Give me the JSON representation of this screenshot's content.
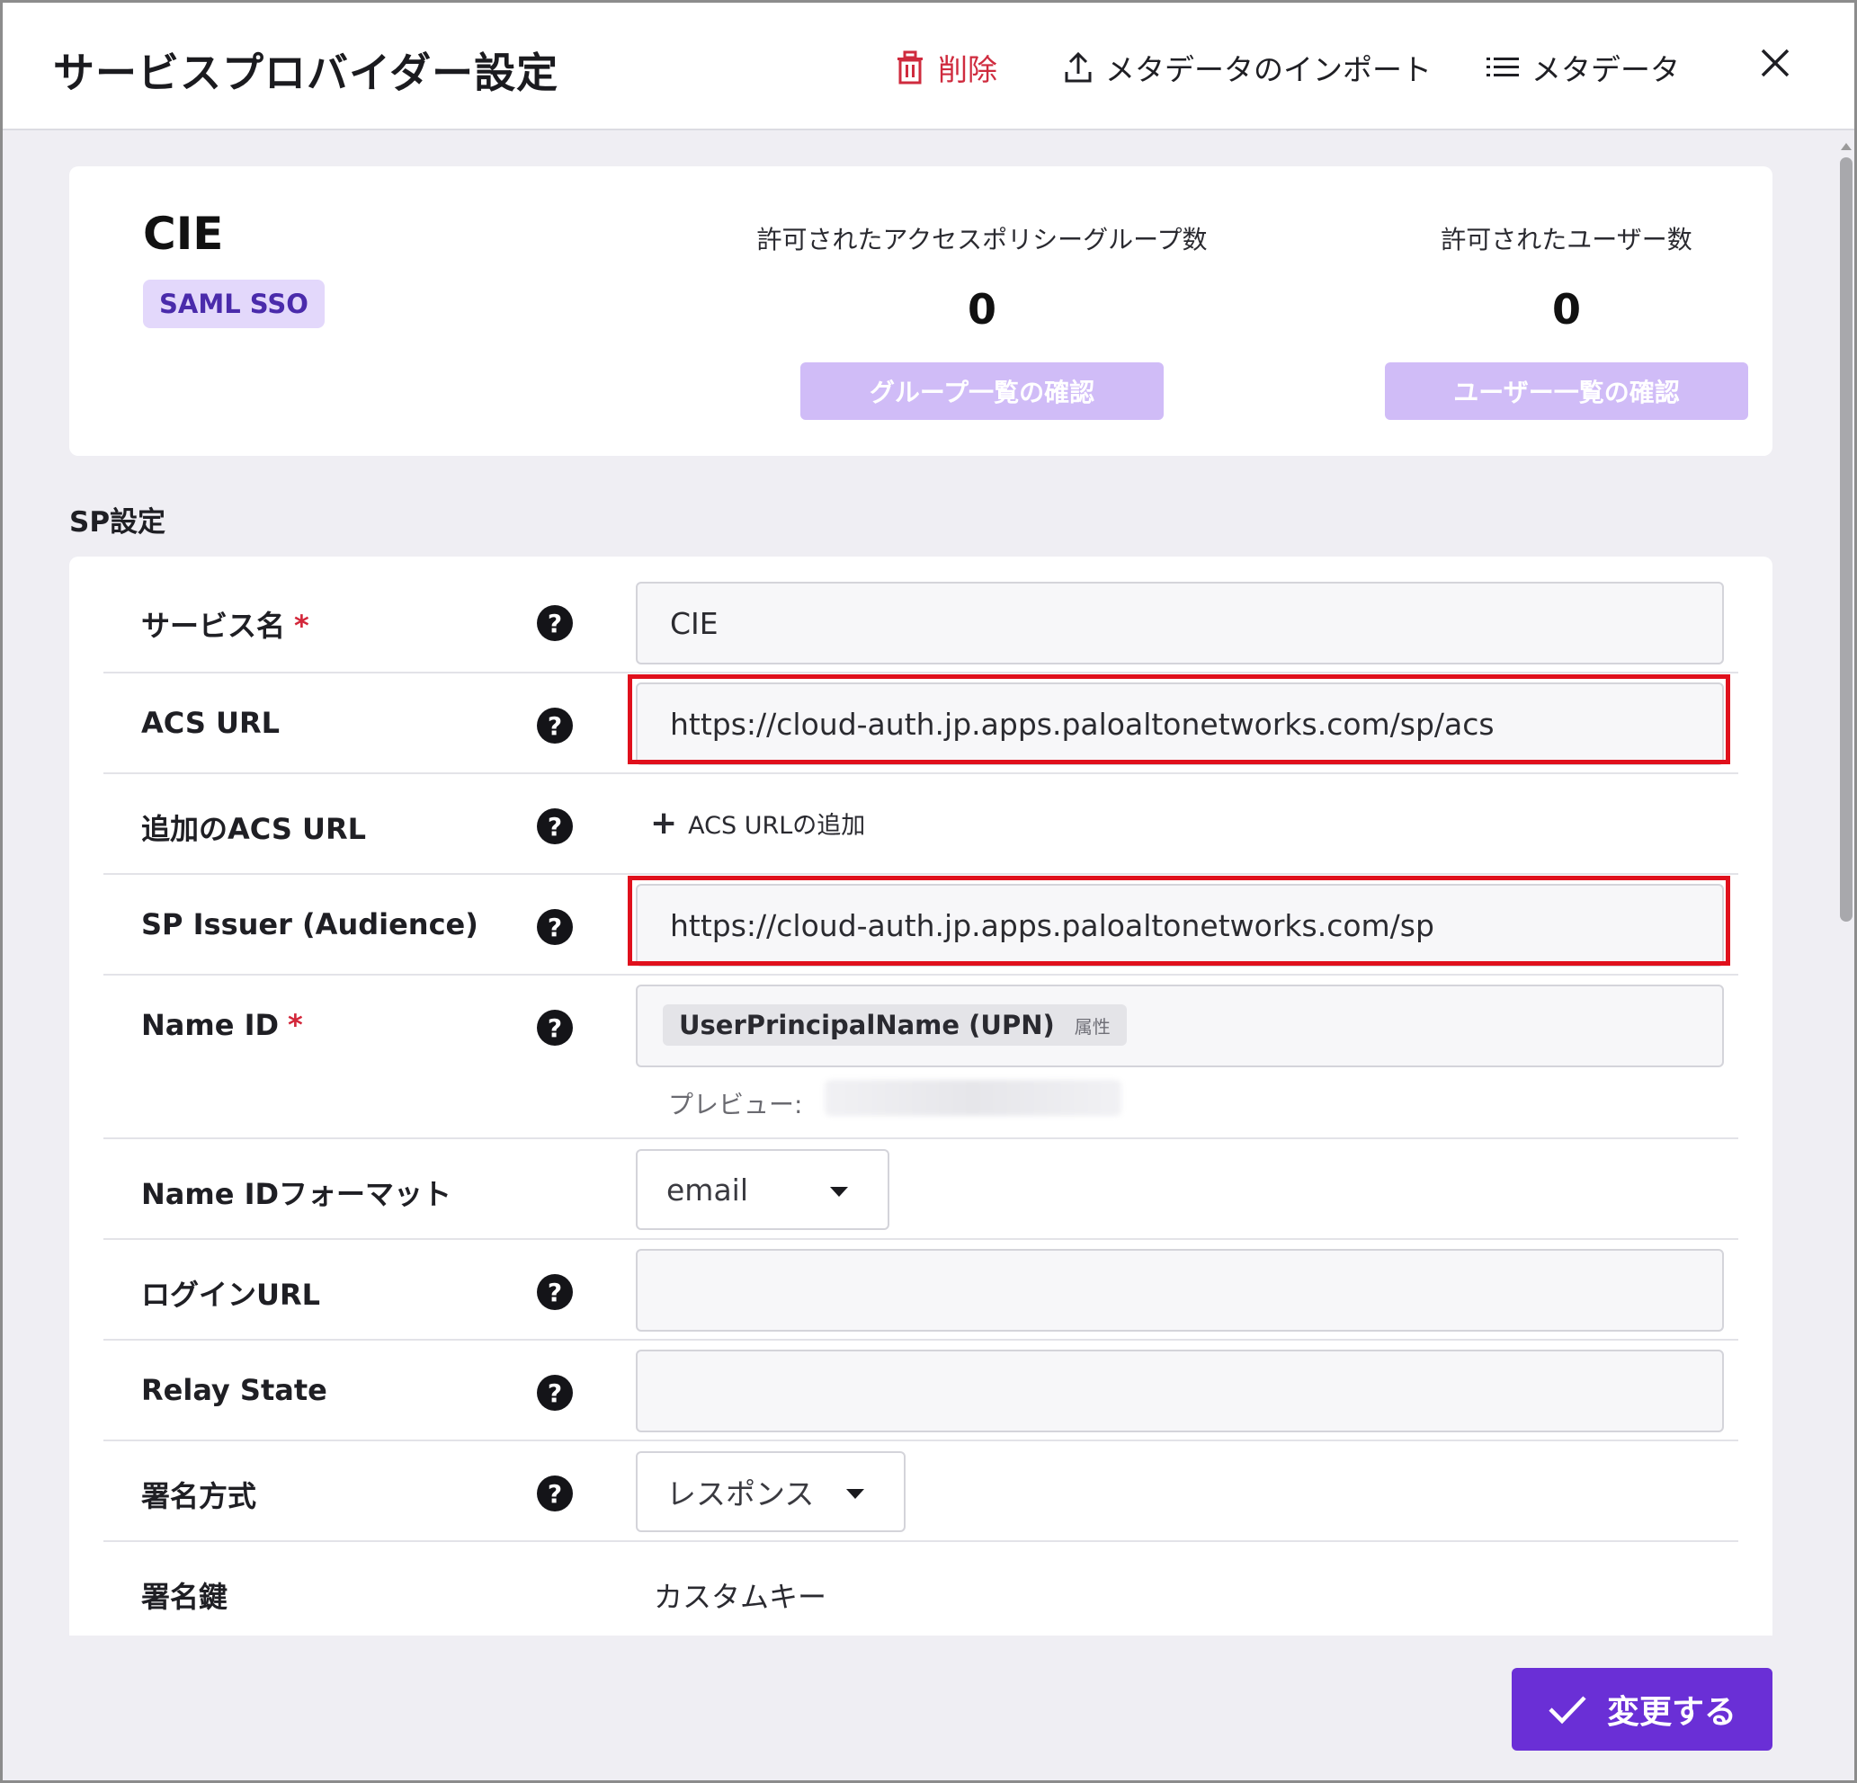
{
  "header": {
    "title": "サービスプロバイダー設定",
    "delete_label": "削除",
    "import_label": "メタデータのインポート",
    "metadata_label": "メタデータ"
  },
  "summary": {
    "name": "CIE",
    "badge": "SAML SSO",
    "groups": {
      "label": "許可されたアクセスポリシーグループ数",
      "value": "0",
      "button": "グループ一覧の確認"
    },
    "users": {
      "label": "許可されたユーザー数",
      "value": "0",
      "button": "ユーザー一覧の確認"
    }
  },
  "section_title": "SP設定",
  "form": {
    "service_name": {
      "label": "サービス名",
      "required": "*",
      "value": "CIE"
    },
    "acs_url": {
      "label": "ACS URL",
      "value": "https://cloud-auth.jp.apps.paloaltonetworks.com/sp/acs"
    },
    "additional_acs": {
      "label": "追加のACS URL",
      "add_label": "ACS URLの追加"
    },
    "sp_issuer": {
      "label": "SP Issuer (Audience)",
      "value": "https://cloud-auth.jp.apps.paloaltonetworks.com/sp"
    },
    "name_id": {
      "label": "Name ID",
      "required": "*",
      "chip": "UserPrincipalName (UPN)",
      "chip_tag": "属性",
      "preview_label": "プレビュー:"
    },
    "name_id_format": {
      "label": "Name IDフォーマット",
      "value": "email"
    },
    "login_url": {
      "label": "ログインURL",
      "value": ""
    },
    "relay_state": {
      "label": "Relay State",
      "value": ""
    },
    "signing_method": {
      "label": "署名方式",
      "value": "レスポンス"
    },
    "signing_key": {
      "label": "署名鍵",
      "value": "カスタムキー"
    }
  },
  "help_glyph": "?",
  "submit_label": "変更する",
  "colors": {
    "accent": "#6a2fd6",
    "danger": "#cf2b3e",
    "highlight": "#e0101c",
    "badge_bg": "#e3d8fb"
  }
}
